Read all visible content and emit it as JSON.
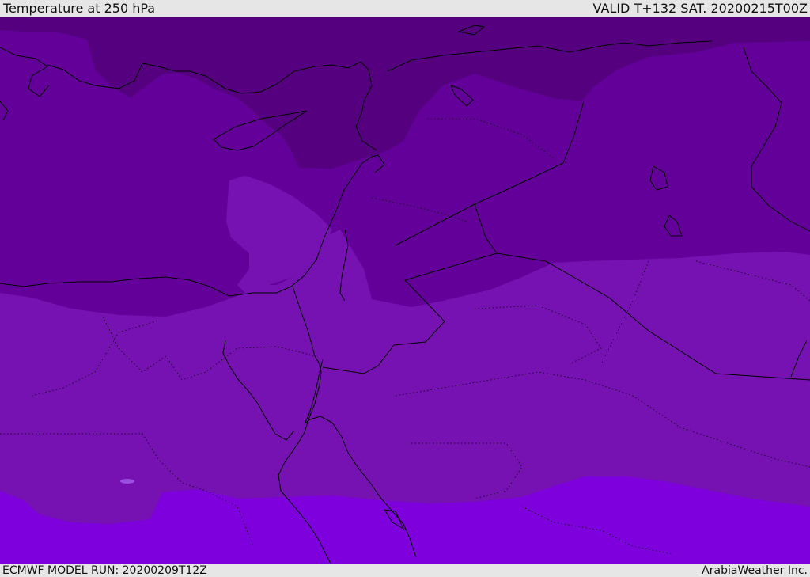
{
  "header": {
    "title": "Temperature at 250 hPa",
    "valid_time": "VALID T+132 SAT. 20200215T00Z"
  },
  "footer": {
    "model_run": "ECMWF MODEL RUN: 20200209T12Z",
    "credit": "ArabiaWeather Inc."
  },
  "map": {
    "colors": {
      "coldest_band": "#54007f",
      "cold_band": "#64009a",
      "mid_band": "#7612b2",
      "warm_band": "#7d00dd",
      "coastline": "#000000"
    }
  }
}
